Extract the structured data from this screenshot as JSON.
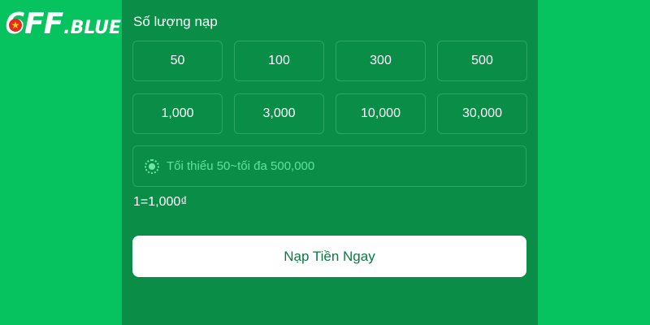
{
  "logo": {
    "main": "6FF",
    "suffix": ".BLUE"
  },
  "deposit": {
    "section_label": "Số lượng nạp",
    "amounts": [
      "50",
      "100",
      "300",
      "500",
      "1,000",
      "3,000",
      "10,000",
      "30,000"
    ],
    "input": {
      "value": "",
      "placeholder": "Tối thiểu 50~tối đa 500,000",
      "icon": "coin-icon"
    },
    "rate": "1=1,000₫",
    "submit_label": "Nạp Tiền Ngay"
  },
  "colors": {
    "background": "#07c35f",
    "panel": "#0a8e47",
    "border": "#2aa765",
    "placeholder": "#5fe39a",
    "button_bg": "#ffffff",
    "button_text": "#0b7a3e"
  }
}
